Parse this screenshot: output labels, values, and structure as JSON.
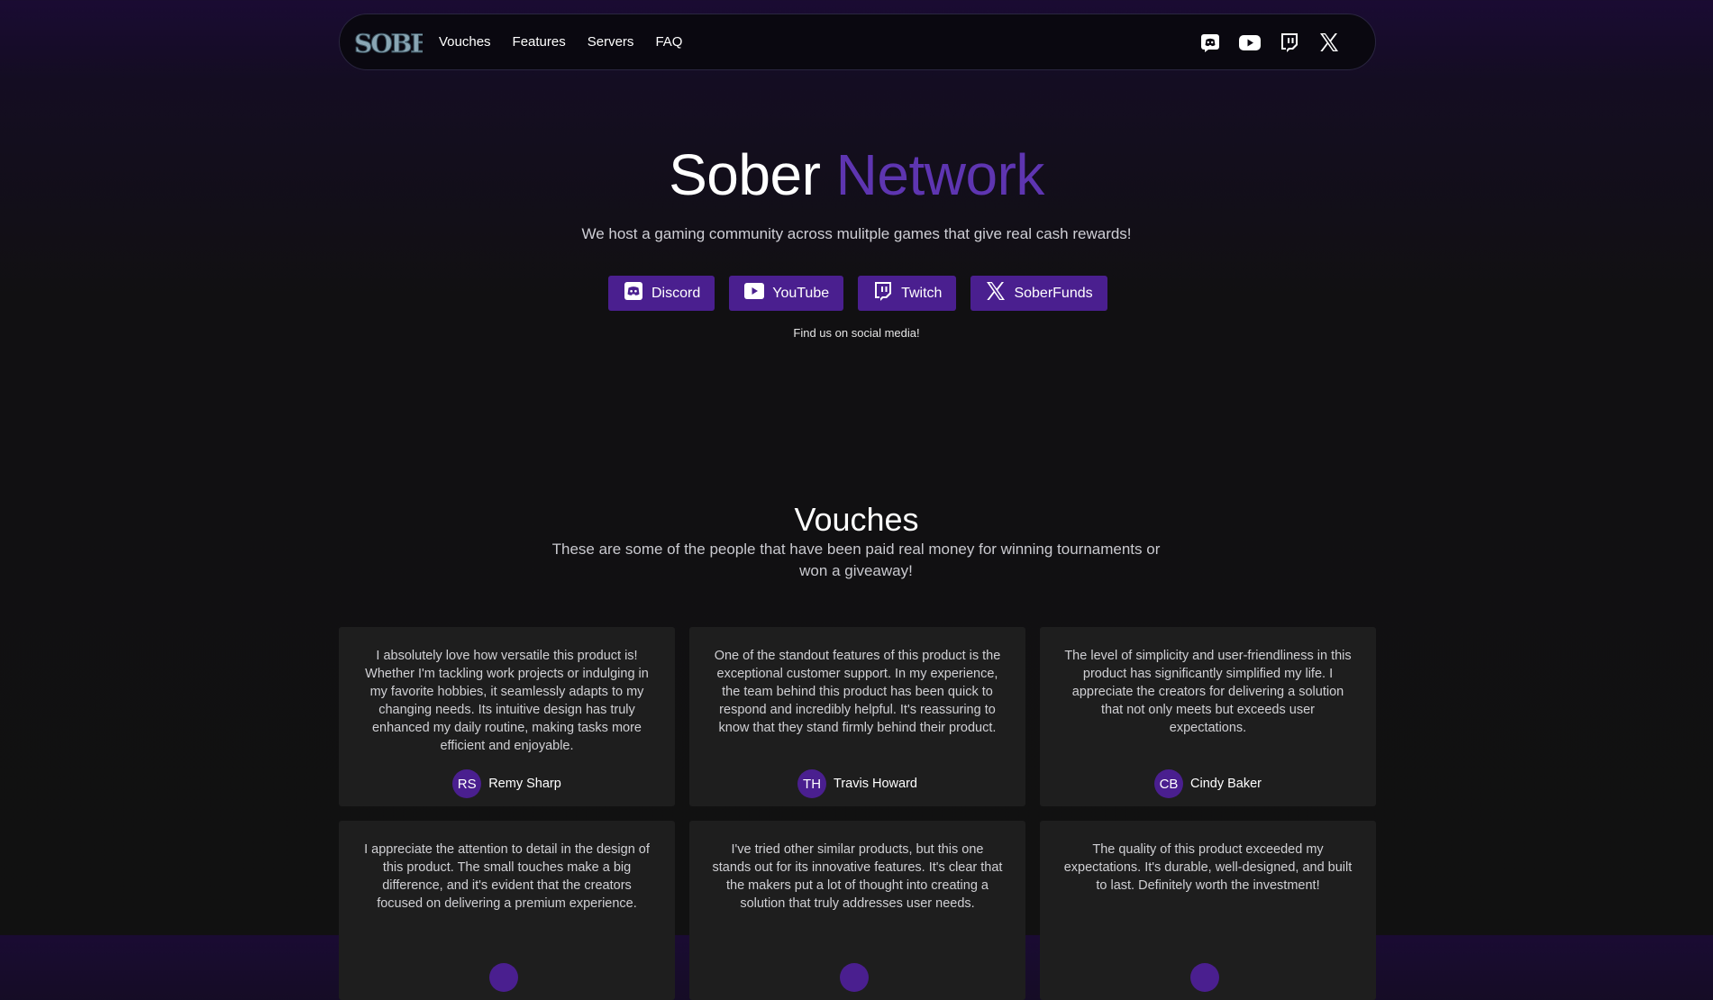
{
  "nav": {
    "logo_text": "SOBER",
    "links": [
      "Vouches",
      "Features",
      "Servers",
      "FAQ"
    ],
    "icons": [
      "discord-icon",
      "youtube-icon",
      "twitch-icon",
      "x-icon"
    ]
  },
  "hero": {
    "title_main": "Sober",
    "title_accent": "Network",
    "subtitle": "We host a gaming community across mulitple games that give real cash rewards!",
    "buttons": [
      {
        "label": "Discord",
        "icon": "discord-icon"
      },
      {
        "label": "YouTube",
        "icon": "youtube-icon"
      },
      {
        "label": "Twitch",
        "icon": "twitch-icon"
      },
      {
        "label": "SoberFunds",
        "icon": "x-icon"
      }
    ],
    "find_us": "Find us on social media!"
  },
  "vouches": {
    "title": "Vouches",
    "subtitle": "These are some of the people that have been paid real money for winning tournaments or won a giveaway!",
    "cards": [
      {
        "text": "I absolutely love how versatile this product is! Whether I'm tackling work projects or indulging in my favorite hobbies, it seamlessly adapts to my changing needs. Its intuitive design has truly enhanced my daily routine, making tasks more efficient and enjoyable.",
        "initials": "RS",
        "name": "Remy Sharp"
      },
      {
        "text": "One of the standout features of this product is the exceptional customer support. In my experience, the team behind this product has been quick to respond and incredibly helpful. It's reassuring to know that they stand firmly behind their product.",
        "initials": "TH",
        "name": "Travis Howard"
      },
      {
        "text": "The level of simplicity and user-friendliness in this product has significantly simplified my life. I appreciate the creators for delivering a solution that not only meets but exceeds user expectations.",
        "initials": "CB",
        "name": "Cindy Baker"
      },
      {
        "text": "I appreciate the attention to detail in the design of this product. The small touches make a big difference, and it's evident that the creators focused on delivering a premium experience.",
        "initials": "",
        "name": ""
      },
      {
        "text": "I've tried other similar products, but this one stands out for its innovative features. It's clear that the makers put a lot of thought into creating a solution that truly addresses user needs.",
        "initials": "",
        "name": ""
      },
      {
        "text": "The quality of this product exceeded my expectations. It's durable, well-designed, and built to last. Definitely worth the investment!",
        "initials": "",
        "name": ""
      }
    ]
  },
  "colors": {
    "accent": "#5e35b1",
    "button": "#4a1f8f",
    "card": "#1e1e1e"
  }
}
